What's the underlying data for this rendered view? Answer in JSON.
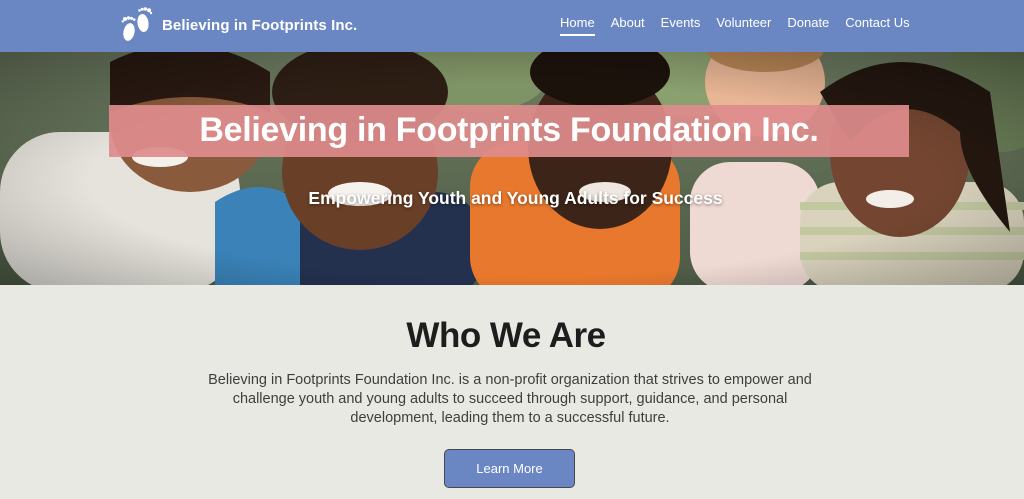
{
  "header": {
    "brand_name": "Believing in Footprints Inc.",
    "brand_logo_icon": "footprints-icon",
    "nav": [
      {
        "label": "Home",
        "active": true
      },
      {
        "label": "About",
        "active": false
      },
      {
        "label": "Events",
        "active": false
      },
      {
        "label": "Volunteer",
        "active": false
      },
      {
        "label": "Donate",
        "active": false
      },
      {
        "label": "Contact Us",
        "active": false
      }
    ]
  },
  "hero": {
    "title": "Believing in Footprints Foundation Inc.",
    "subtitle": "Empowering Youth and Young Adults for Success",
    "image_alt": "smiling-children-photo"
  },
  "about": {
    "heading": "Who We Are",
    "body": "Believing in Footprints Foundation Inc. is a non-profit organization that strives to empower and challenge youth and young adults to succeed through support, guidance, and personal development, leading them to a successful future.",
    "button_label": "Learn More"
  },
  "colors": {
    "header_bg": "#6a87c4",
    "title_band": "#de8c8c",
    "page_bg": "#e9e9e3",
    "button_bg": "#6a87c4"
  }
}
